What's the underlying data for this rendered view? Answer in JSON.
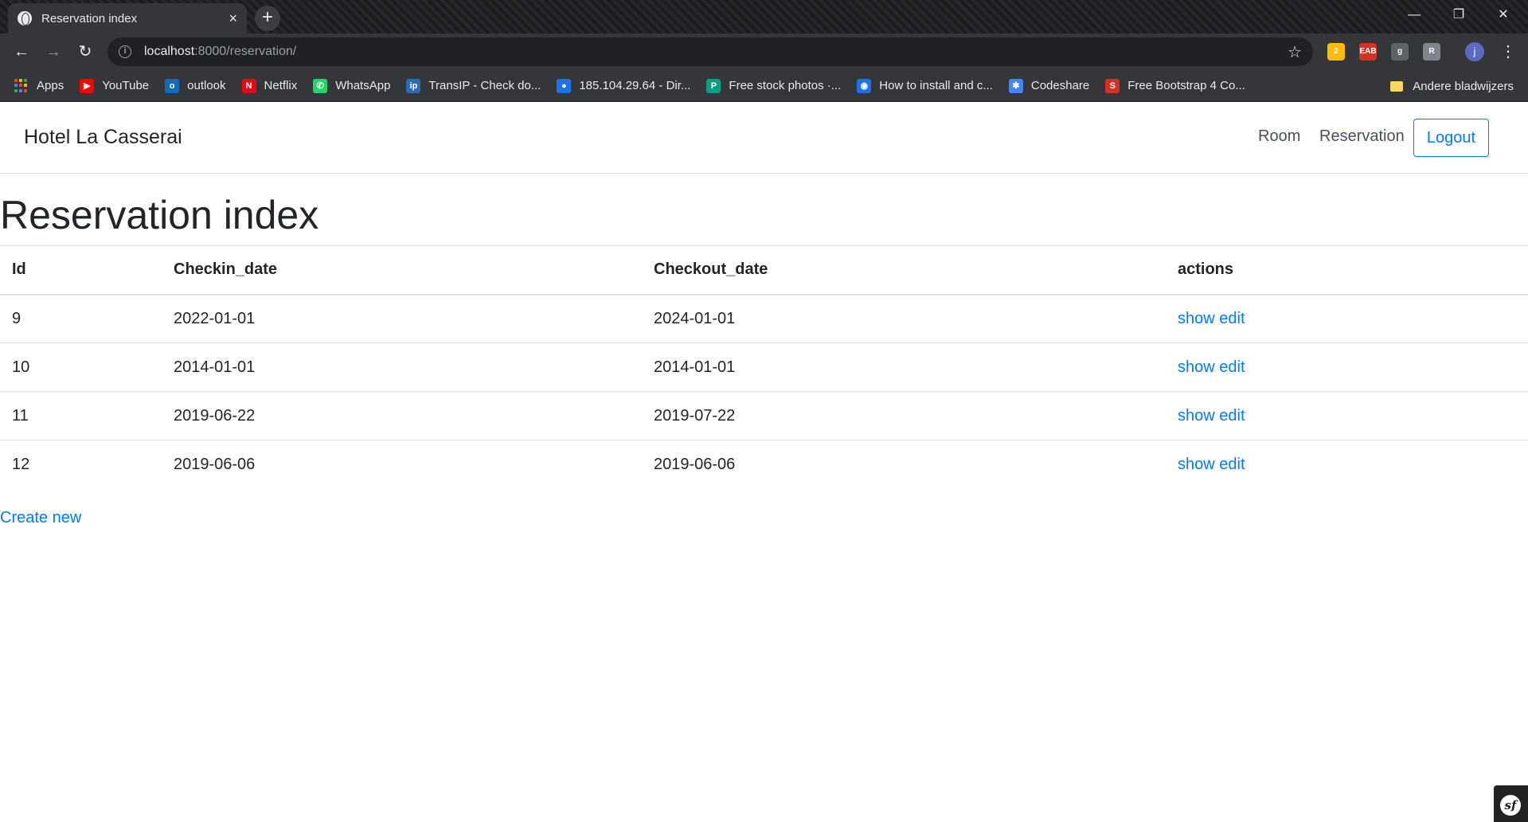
{
  "browser": {
    "tab_title": "Reservation index",
    "tab_close": "×",
    "new_tab": "+",
    "window_controls": {
      "minimize": "—",
      "restore": "❐",
      "close": "✕"
    },
    "nav": {
      "back": "←",
      "forward": "→",
      "reload": "↻"
    },
    "url_host": "localhost",
    "url_path": ":8000/reservation/",
    "star": "☆",
    "extensions": [
      {
        "label": "2",
        "color": "#fbbc04"
      },
      {
        "label": "EAB",
        "color": "#d93025"
      },
      {
        "label": "g",
        "color": "#5f6368"
      },
      {
        "label": "R",
        "color": "#80868b"
      }
    ],
    "profile_initial": "j",
    "menu": "⋮",
    "bookmarks": [
      {
        "label": "Apps",
        "icon": "apps-icon"
      },
      {
        "label": "YouTube",
        "icon": "youtube-icon",
        "color": "#ff0000",
        "glyph": "▶"
      },
      {
        "label": "outlook",
        "icon": "outlook-icon",
        "color": "#0f6cbd",
        "glyph": "o"
      },
      {
        "label": "Netflix",
        "icon": "netflix-icon",
        "color": "#e50914",
        "glyph": "N"
      },
      {
        "label": "WhatsApp",
        "icon": "whatsapp-icon",
        "color": "#25d366",
        "glyph": "✆"
      },
      {
        "label": "TransIP - Check do...",
        "icon": "transip-icon",
        "color": "#2b6cb0",
        "glyph": "ip"
      },
      {
        "label": "185.104.29.64 - Dir...",
        "icon": "server-icon",
        "color": "#1a73e8",
        "glyph": "●"
      },
      {
        "label": "Free stock photos ·...",
        "icon": "pexels-icon",
        "color": "#05a081",
        "glyph": "P"
      },
      {
        "label": "How to install and c...",
        "icon": "eye-icon",
        "color": "#1a73e8",
        "glyph": "◉"
      },
      {
        "label": "Codeshare",
        "icon": "codeshare-icon",
        "color": "#4285f4",
        "glyph": "✱"
      },
      {
        "label": "Free Bootstrap 4 Co...",
        "icon": "bootstrap-icon",
        "color": "#d93025",
        "glyph": "S"
      }
    ],
    "other_bookmarks": "Andere bladwijzers"
  },
  "page": {
    "brand": "Hotel La Casserai",
    "nav_room": "Room",
    "nav_reservation": "Reservation",
    "logout": "Logout",
    "heading": "Reservation index",
    "table": {
      "headers": [
        "Id",
        "Checkin_date",
        "Checkout_date",
        "actions"
      ],
      "rows": [
        {
          "id": "9",
          "checkin": "2022-01-01",
          "checkout": "2024-01-01",
          "show": "show",
          "edit": "edit"
        },
        {
          "id": "10",
          "checkin": "2014-01-01",
          "checkout": "2014-01-01",
          "show": "show",
          "edit": "edit"
        },
        {
          "id": "11",
          "checkin": "2019-06-22",
          "checkout": "2019-07-22",
          "show": "show",
          "edit": "edit"
        },
        {
          "id": "12",
          "checkin": "2019-06-06",
          "checkout": "2019-06-06",
          "show": "show",
          "edit": "edit"
        }
      ]
    },
    "create_new": "Create new",
    "symfony_logo": "sf"
  }
}
